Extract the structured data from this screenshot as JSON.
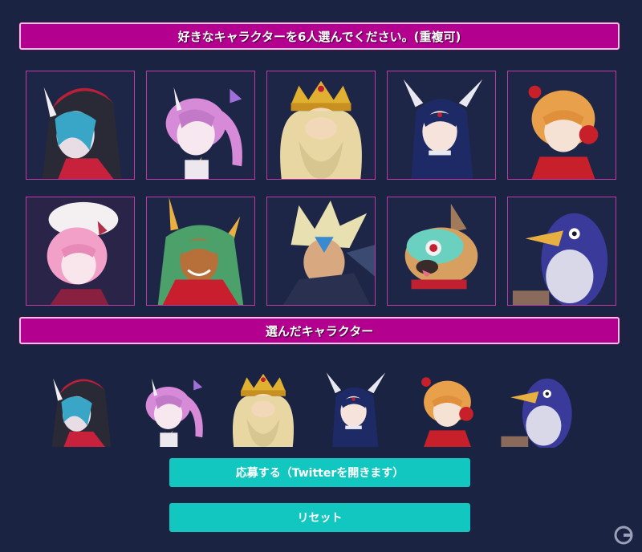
{
  "header": {
    "instruction": "好きなキャラクターを6人選んでください。(重複可)"
  },
  "grid": {
    "characters": [
      {
        "name": "hooded-horned-girl",
        "icon": "hooded-horned-girl-portrait",
        "hair": "#3aa6c7",
        "accent": "#c8213b"
      },
      {
        "name": "pink-pigtail-girl",
        "icon": "pink-pigtail-girl-portrait",
        "hair": "#d68ad8",
        "accent": "#f0c84a"
      },
      {
        "name": "bearded-king",
        "icon": "bearded-king-portrait",
        "hair": "#e8d7a3",
        "accent": "#e0b030"
      },
      {
        "name": "dark-haired-winged-woman",
        "icon": "dark-haired-winged-woman-portrait",
        "hair": "#1e2a66",
        "accent": "#e8e8f0"
      },
      {
        "name": "orange-haired-headphone-girl",
        "icon": "orange-haired-headphone-girl-portrait",
        "hair": "#e8a04a",
        "accent": "#c8202a"
      },
      {
        "name": "pink-haired-hat-girl",
        "icon": "pink-haired-hat-girl-portrait",
        "hair": "#f2a0c8",
        "accent": "#ffffff"
      },
      {
        "name": "green-haired-horned-demon",
        "icon": "green-haired-horned-demon-portrait",
        "hair": "#4ca06a",
        "accent": "#c81e2e"
      },
      {
        "name": "spiky-blonde-warrior",
        "icon": "spiky-blonde-warrior-portrait",
        "hair": "#e8e0b0",
        "accent": "#3a8ad0"
      },
      {
        "name": "masked-pug-dog",
        "icon": "masked-pug-dog-portrait",
        "hair": "#d8a060",
        "accent": "#6ad0c0"
      },
      {
        "name": "prinny-penguin",
        "icon": "prinny-penguin-portrait",
        "hair": "#3a3a9a",
        "accent": "#e8b040"
      }
    ]
  },
  "selected": {
    "title": "選んだキャラクター",
    "items": [
      {
        "name": "hooded-horned-girl",
        "icon": "hooded-horned-girl-portrait"
      },
      {
        "name": "pink-pigtail-girl",
        "icon": "pink-pigtail-girl-portrait"
      },
      {
        "name": "bearded-king",
        "icon": "bearded-king-portrait"
      },
      {
        "name": "dark-haired-winged-woman",
        "icon": "dark-haired-winged-woman-portrait"
      },
      {
        "name": "orange-haired-headphone-girl",
        "icon": "orange-haired-headphone-girl-portrait"
      },
      {
        "name": "prinny-penguin",
        "icon": "prinny-penguin-portrait"
      }
    ]
  },
  "actions": {
    "apply_label": "応募する（Twitterを開きます）",
    "reset_label": "リセット"
  },
  "colors": {
    "background": "#1b2342",
    "banner": "#b3008f",
    "button": "#12c7c0",
    "cell_border": "#c03aa6"
  }
}
